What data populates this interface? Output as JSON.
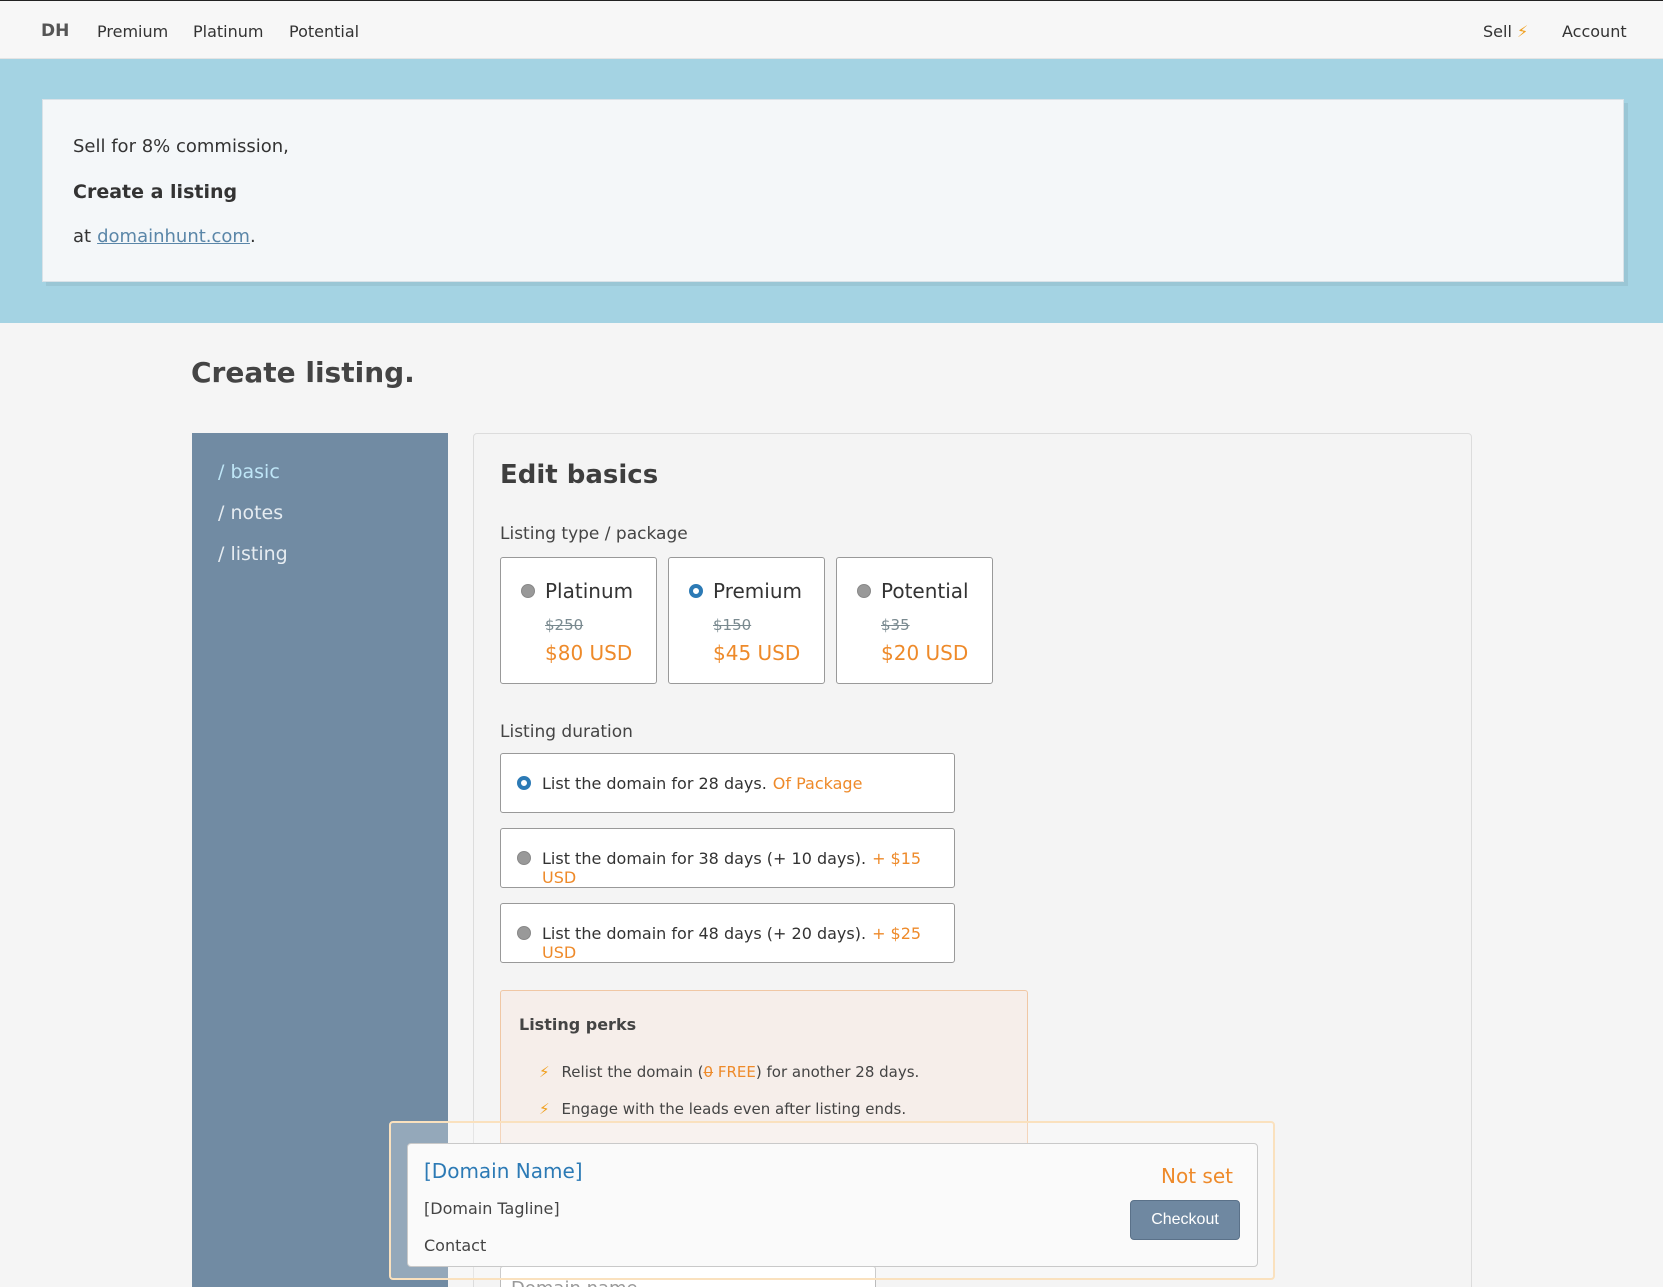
{
  "nav": {
    "brand": "DH",
    "links": [
      "Premium",
      "Platinum",
      "Potential"
    ],
    "sell": "Sell",
    "account": "Account"
  },
  "hero": {
    "line1": "Sell for 8% commission,",
    "line2": "Create a listing",
    "line3_prefix": "at",
    "line3_link": "domainhunt.com",
    "line3_suffix": "."
  },
  "page": {
    "title": "Create listing."
  },
  "sidebar": {
    "items": [
      "/ basic",
      "/ notes",
      "/ listing"
    ],
    "active": "/ basic"
  },
  "form": {
    "title": "Edit basics",
    "package_label": "Listing type / package",
    "packages": [
      {
        "name": "Platinum",
        "old_price": "$250",
        "price": "$80 USD",
        "selected": false
      },
      {
        "name": "Premium",
        "old_price": "$150",
        "price": "$45 USD",
        "selected": true
      },
      {
        "name": "Potential",
        "old_price": "$35",
        "price": "$20 USD",
        "selected": false
      }
    ],
    "duration_label": "Listing duration",
    "durations": [
      {
        "text": "List the domain for 28 days.",
        "extra": "Of Package",
        "selected": true
      },
      {
        "text": "List the domain for 38 days (+ 10 days).",
        "extra": "+ $15 USD",
        "selected": false
      },
      {
        "text": "List the domain for 48 days (+ 20 days).",
        "extra": "+ $25 USD",
        "selected": false
      }
    ],
    "perks": {
      "title": "Listing perks",
      "perk1_prefix": "Relist the domain (",
      "perk1_strike": "0",
      "perk1_free": "FREE",
      "perk1_suffix": ") for another 28 days.",
      "perk2": "Engage with the leads even after listing ends."
    },
    "domain_placeholder": "Domain name"
  },
  "floating": {
    "name": "[Domain Name]",
    "tagline": "[Domain Tagline]",
    "contact": "Contact",
    "status": "Not set",
    "checkout": "Checkout"
  },
  "colors": {
    "accent": "#ee8a2a",
    "primary": "#2c7ab5",
    "hero_bg": "#a4d3e3",
    "sidebar_bg": "#718ba3"
  }
}
